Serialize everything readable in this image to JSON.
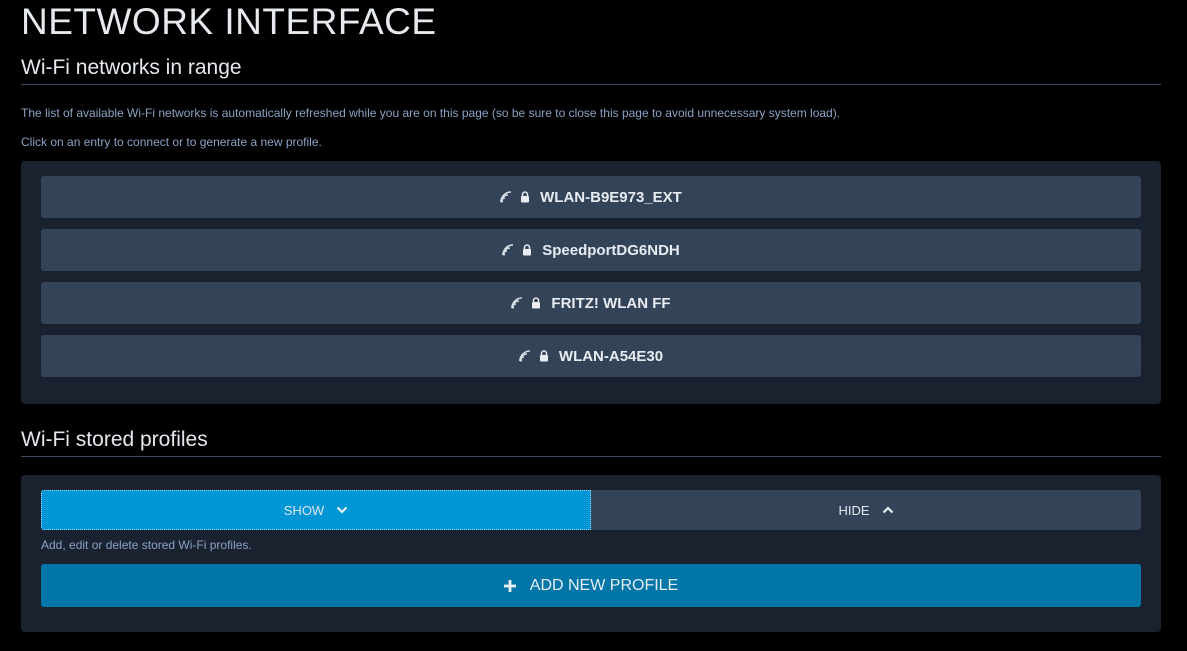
{
  "page": {
    "title": "NETWORK INTERFACE"
  },
  "networks_section": {
    "heading": "Wi-Fi networks in range",
    "description_1": "The list of available Wi-Fi networks is automatically refreshed while you are on this page (so be sure to close this page to avoid unnecessary system load).",
    "description_2": "Click on an entry to connect or to generate a new profile.",
    "networks": [
      {
        "ssid": "WLAN-B9E973_EXT",
        "signal_icon": "wifi-signal-icon",
        "security_icon": "lock-icon"
      },
      {
        "ssid": "SpeedportDG6NDH",
        "signal_icon": "wifi-signal-icon",
        "security_icon": "lock-icon"
      },
      {
        "ssid": "FRITZ! WLAN FF",
        "signal_icon": "wifi-signal-icon",
        "security_icon": "lock-icon"
      },
      {
        "ssid": "WLAN-A54E30",
        "signal_icon": "wifi-signal-icon",
        "security_icon": "lock-icon"
      }
    ]
  },
  "profiles_section": {
    "heading": "Wi-Fi stored profiles",
    "show_label": "SHOW",
    "hide_label": "HIDE",
    "active_toggle": "show",
    "description": "Add, edit or delete stored Wi-Fi profiles.",
    "add_label": "ADD NEW PROFILE"
  },
  "colors": {
    "background": "#000000",
    "panel": "#1a2230",
    "item": "#334459",
    "accent_active": "#0096d6",
    "accent_add": "#0076a8",
    "muted_text": "#8aa3c4"
  }
}
